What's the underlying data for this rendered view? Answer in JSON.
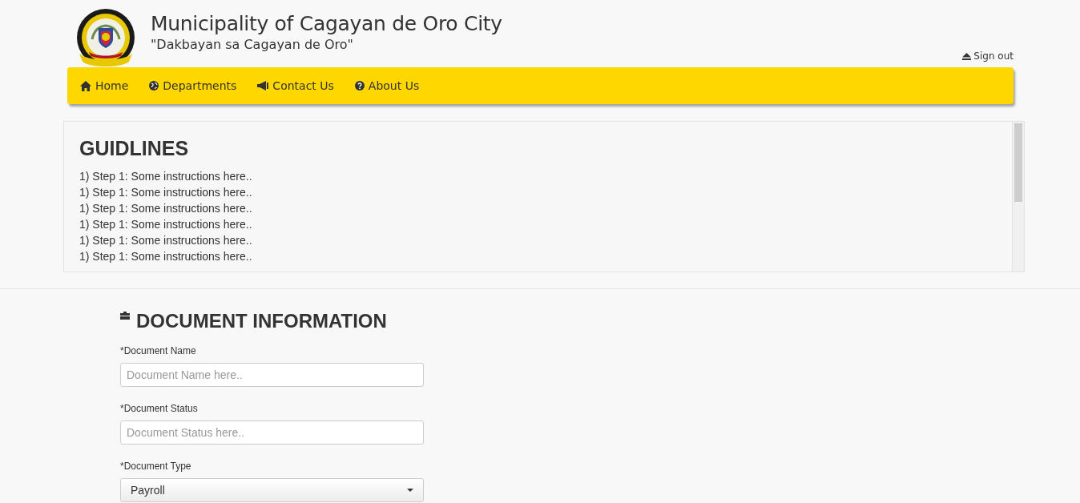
{
  "header": {
    "title": "Municipality of Cagayan de Oro City",
    "subtitle": "\"Dakbayan sa Cagayan de Oro\"",
    "sign_out": "Sign out"
  },
  "nav": [
    {
      "kind": "home",
      "label": "Home"
    },
    {
      "kind": "globe",
      "label": "Departments"
    },
    {
      "kind": "megaphone",
      "label": "Contact Us"
    },
    {
      "kind": "question",
      "label": "About Us"
    }
  ],
  "guidelines": {
    "title": "GUIDLINES",
    "steps": [
      "1) Step 1: Some instructions here..",
      "1) Step 1: Some instructions here..",
      "1) Step 1: Some instructions here..",
      "1) Step 1: Some instructions here..",
      "1) Step 1: Some instructions here..",
      "1) Step 1: Some instructions here.."
    ]
  },
  "document": {
    "title": "DOCUMENT INFORMATION",
    "fields": [
      {
        "kind": "text",
        "label": "*Document Name",
        "placeholder": "Document Name here.."
      },
      {
        "kind": "text",
        "label": "*Document Status",
        "placeholder": "Document Status here.."
      },
      {
        "kind": "select",
        "label": "*Document Type",
        "value": "Payroll"
      }
    ]
  }
}
